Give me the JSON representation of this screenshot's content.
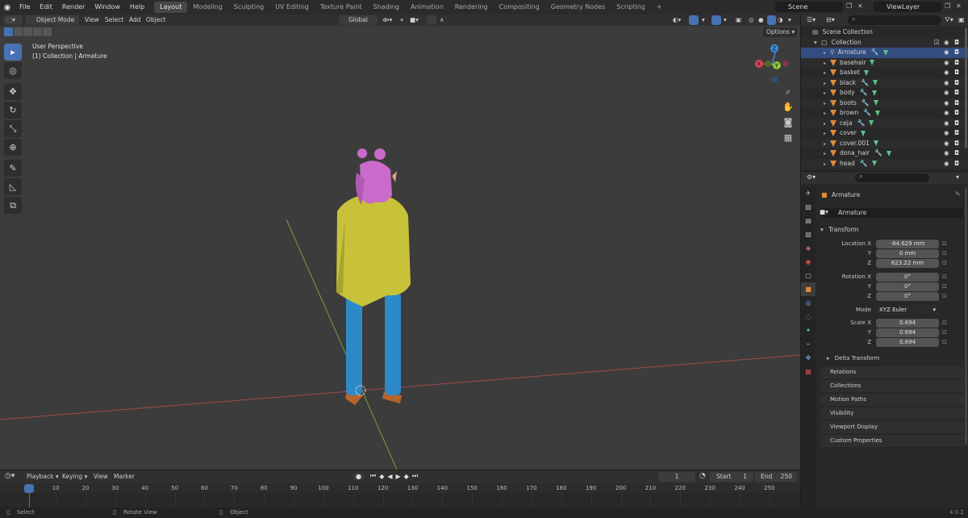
{
  "topbar": {
    "menus": [
      "File",
      "Edit",
      "Render",
      "Window",
      "Help"
    ],
    "workspaces": [
      "Layout",
      "Modeling",
      "Sculpting",
      "UV Editing",
      "Texture Paint",
      "Shading",
      "Animation",
      "Rendering",
      "Compositing",
      "Geometry Nodes",
      "Scripting"
    ],
    "active_workspace": "Layout",
    "add_tab": "+",
    "scene": "Scene",
    "view_layer": "ViewLayer"
  },
  "viewport_header": {
    "mode": "Object Mode",
    "menus": [
      "View",
      "Select",
      "Add",
      "Object"
    ],
    "orientation": "Global",
    "options": "Options"
  },
  "viewport": {
    "perspective": "User Perspective",
    "context": "(1) Collection | Armature",
    "gizmo": {
      "x": "X",
      "y": "Y",
      "z": "Z"
    }
  },
  "timeline": {
    "menus": [
      "Playback",
      "Keying",
      "View",
      "Marker"
    ],
    "current_frame": "1",
    "start_label": "Start",
    "start": "1",
    "end_label": "End",
    "end": "250",
    "ticks": [
      "1",
      "10",
      "20",
      "30",
      "40",
      "50",
      "60",
      "70",
      "80",
      "90",
      "100",
      "110",
      "120",
      "130",
      "140",
      "150",
      "160",
      "170",
      "180",
      "190",
      "200",
      "210",
      "220",
      "230",
      "240",
      "250"
    ]
  },
  "status": {
    "select": "Select",
    "rotate": "Rotate View",
    "object": "Object",
    "version": "4.0.2"
  },
  "outliner": {
    "scene_collection": "Scene Collection",
    "collection": "Collection",
    "items": [
      "Armature",
      "basehair",
      "basket",
      "black",
      "body",
      "boots",
      "brown",
      "ceja",
      "cover",
      "cover.001",
      "dona_hair",
      "head"
    ],
    "selected": "Armature"
  },
  "properties": {
    "object_name": "Armature",
    "data_name": "Armature",
    "transform": "Transform",
    "location_label": "Location X",
    "location": [
      "-84.629 mm",
      "0 mm",
      "623.22 mm"
    ],
    "rotation_label": "Rotation X",
    "rotation": [
      "0°",
      "0°",
      "0°"
    ],
    "mode_label": "Mode",
    "mode": "XYZ Euler",
    "scale_label": "Scale X",
    "scale": [
      "0.694",
      "0.694",
      "0.694"
    ],
    "axis_y": "Y",
    "axis_z": "Z",
    "panels": [
      "Delta Transform",
      "Relations",
      "Collections",
      "Motion Paths",
      "Visibility",
      "Viewport Display",
      "Custom Properties"
    ]
  },
  "colors": {
    "accent": "#4772b3",
    "selected_row": "#334d80",
    "x_axis": "#e0445a",
    "y_axis": "#8ac43e",
    "z_axis": "#3d8cde"
  }
}
